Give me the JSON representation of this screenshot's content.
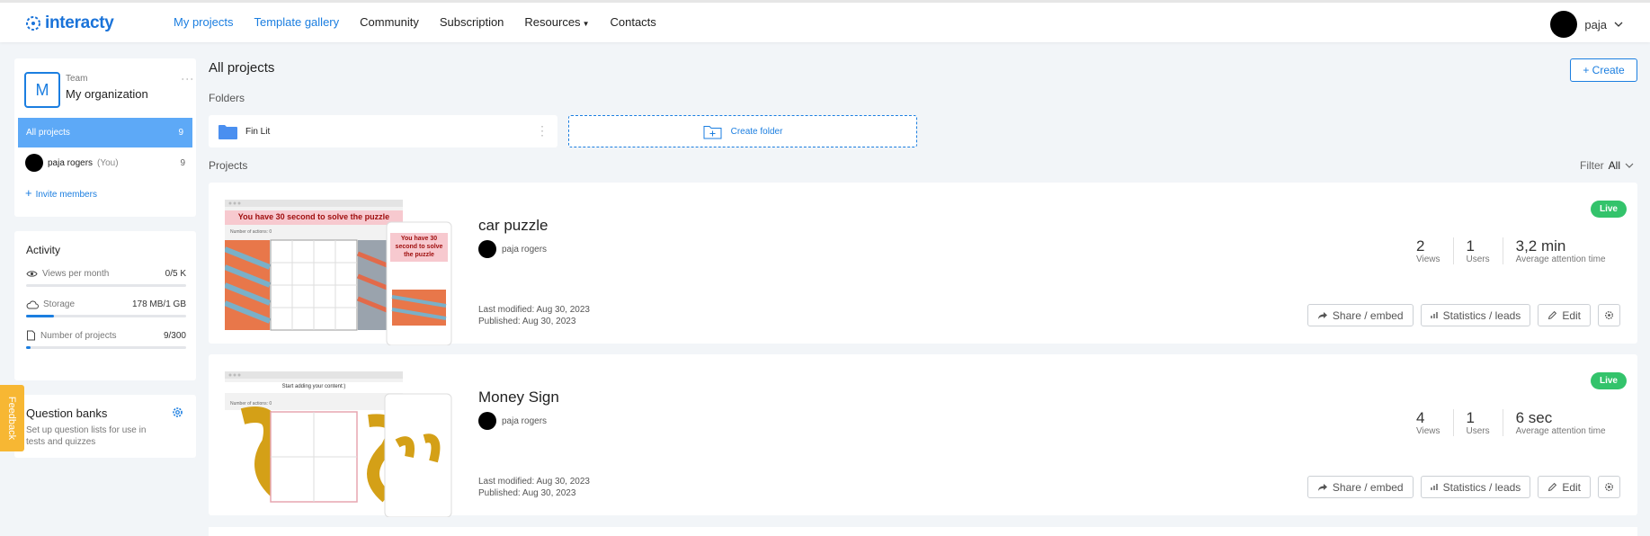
{
  "header": {
    "logo": "interacty",
    "nav": [
      "My projects",
      "Template gallery",
      "Community",
      "Subscription",
      "Resources",
      "Contacts"
    ],
    "user_name": "paja"
  },
  "sidebar": {
    "team_initial": "M",
    "team_label": "Team",
    "org_name": "My organization",
    "all_projects_label": "All projects",
    "all_projects_count": "9",
    "member_name": "paja rogers",
    "member_you": "(You)",
    "member_count": "9",
    "invite_label": "Invite members"
  },
  "activity": {
    "title": "Activity",
    "rows": [
      {
        "label": "Views per month",
        "value": "0/5 K",
        "fraction": 0.0
      },
      {
        "label": "Storage",
        "value": "178 MB/1 GB",
        "fraction": 0.174
      },
      {
        "label": "Number of projects",
        "value": "9/300",
        "fraction": 0.03
      }
    ]
  },
  "question_banks": {
    "title": "Question banks",
    "description": "Set up question lists for use in tests and quizzes"
  },
  "feedback_label": "Feedback",
  "main": {
    "title": "All projects",
    "create_label": "+ Create",
    "folders_label": "Folders",
    "folder_name": "Fin Lit",
    "create_folder_label": "Create folder",
    "projects_label": "Projects",
    "filter_label": "Filter",
    "filter_value": "All"
  },
  "projects": [
    {
      "name": "car puzzle",
      "owner": "paja rogers",
      "last_modified": "Last modified: Aug 30, 2023",
      "published": "Published: Aug 30, 2023",
      "status": "Live",
      "views": "2",
      "views_label": "Views",
      "users": "1",
      "users_label": "Users",
      "attention": "3,2 min",
      "attention_label": "Average attention time",
      "thumb_banner": "You have 30 second to solve the puzzle",
      "thumb_mobile_banner": "You have 30 second to solve the puzzle",
      "thumb_counter": "Number of actions: 0"
    },
    {
      "name": "Money Sign",
      "owner": "paja rogers",
      "last_modified": "Last modified: Aug 30, 2023",
      "published": "Published: Aug 30, 2023",
      "status": "Live",
      "views": "4",
      "views_label": "Views",
      "users": "1",
      "users_label": "Users",
      "attention": "6 sec",
      "attention_label": "Average attention time",
      "thumb_banner": "Start adding your content:)",
      "thumb_counter": "Number of actions: 0"
    }
  ],
  "project_actions": {
    "share": "Share / embed",
    "stats": "Statistics / leads",
    "edit": "Edit"
  },
  "colors": {
    "accent": "#1b7ee0",
    "sidebar_active": "#5da9f7",
    "live": "#33c36b",
    "feedback": "#f7b733",
    "thumb_banner": "#f7c9cf"
  }
}
